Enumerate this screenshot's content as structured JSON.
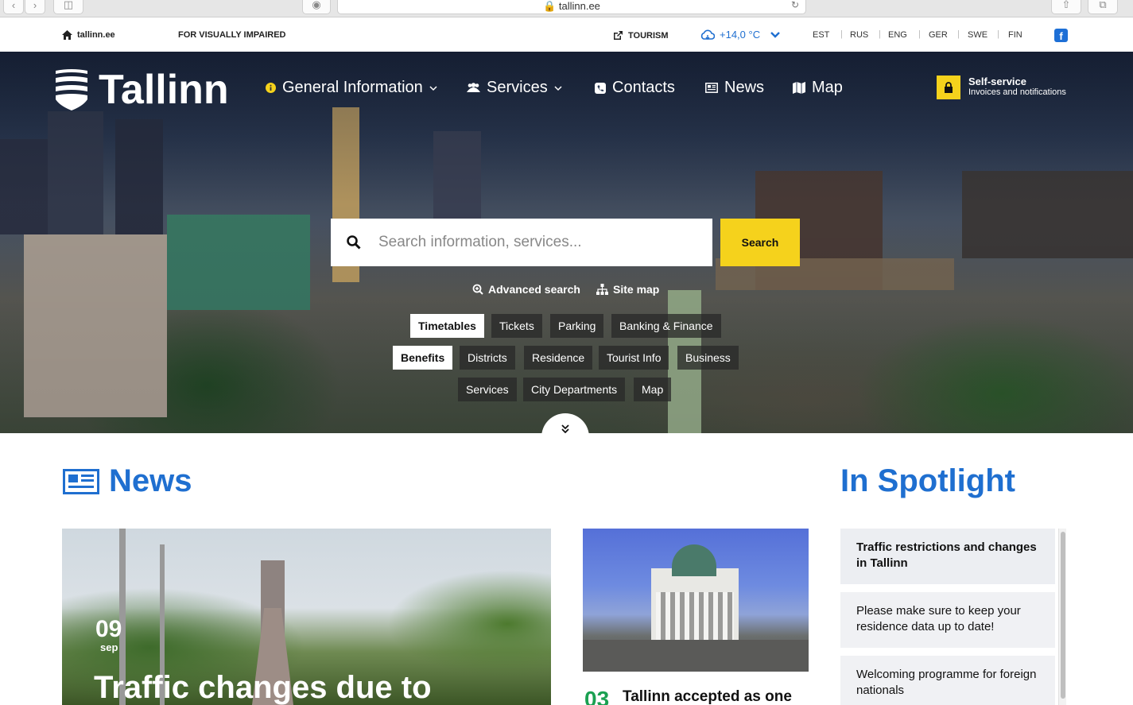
{
  "browser": {
    "url": "tallinn.ee"
  },
  "utility_bar": {
    "home_link": "tallinn.ee",
    "visually_impaired": "FOR VISUALLY IMPAIRED",
    "tourism": "TOURISM",
    "weather": "+14,0 °C",
    "languages": [
      "EST",
      "RUS",
      "ENG",
      "GER",
      "SWE",
      "FIN"
    ]
  },
  "header": {
    "logo_text": "Tallinn",
    "nav": [
      {
        "label": "General Information",
        "icon": "info-icon",
        "has_dropdown": true
      },
      {
        "label": "Services",
        "icon": "users-icon",
        "has_dropdown": true
      },
      {
        "label": "Contacts",
        "icon": "phone-icon",
        "has_dropdown": false
      },
      {
        "label": "News",
        "icon": "newspaper-icon",
        "has_dropdown": false
      },
      {
        "label": "Map",
        "icon": "map-icon",
        "has_dropdown": false
      }
    ],
    "self_service": {
      "title": "Self-service",
      "subtitle": "Invoices and notifications"
    }
  },
  "search": {
    "placeholder": "Search information, services...",
    "button": "Search",
    "advanced": "Advanced search",
    "sitemap": "Site map"
  },
  "quick_tags": [
    "Timetables",
    "Tickets",
    "Parking",
    "Banking & Finance",
    "Benefits",
    "Districts",
    "Residence",
    "Tourist Info",
    "Business",
    "Services",
    "City Departments",
    "Map"
  ],
  "news": {
    "heading": "News",
    "featured": {
      "day": "09",
      "month": "sep",
      "title": "Traffic changes due to"
    },
    "second": {
      "day": "03",
      "title": "Tallinn accepted as one"
    }
  },
  "spotlight": {
    "heading": "In Spotlight",
    "items": [
      "Traffic restrictions and changes in Tallinn",
      "Please make sure to keep your residence data up to date!",
      "Welcoming programme for foreign nationals"
    ]
  },
  "colors": {
    "brand_blue": "#1f6fd0",
    "accent_yellow": "#f5d21c",
    "date_green": "#1aa051"
  }
}
